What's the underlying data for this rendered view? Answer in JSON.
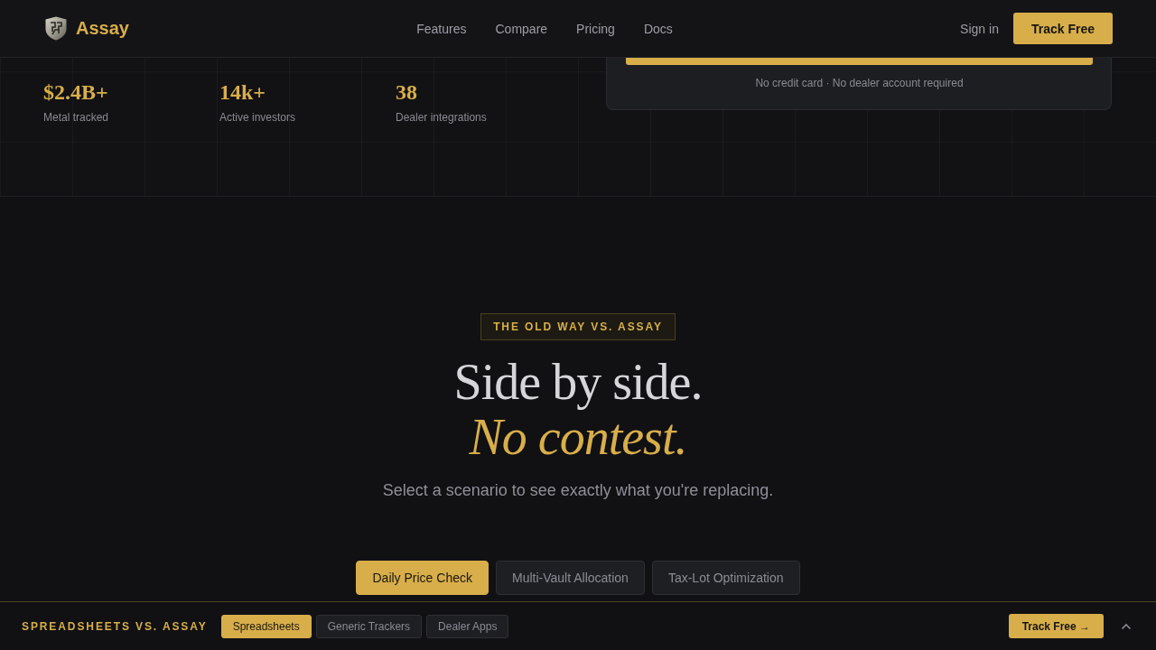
{
  "header": {
    "brand": "Assay",
    "nav": [
      "Features",
      "Compare",
      "Pricing",
      "Docs"
    ],
    "sign_in": "Sign in",
    "cta": "Track Free"
  },
  "hero": {
    "stats": [
      {
        "value": "$2.4B+",
        "label": "Metal tracked"
      },
      {
        "value": "14k+",
        "label": "Active investors"
      },
      {
        "value": "38",
        "label": "Dealer integrations"
      }
    ],
    "signup_card": {
      "note": "No credit card · No dealer account required"
    }
  },
  "comparison": {
    "eyebrow": "THE OLD WAY VS. ASSAY",
    "title": "Side by side.",
    "title_accent": "No contest.",
    "subtitle": "Select a scenario to see exactly what you're replacing.",
    "scenarios": [
      {
        "label": "Daily Price Check",
        "selected": true
      },
      {
        "label": "Multi-Vault Allocation",
        "selected": false
      },
      {
        "label": "Tax-Lot Optimization",
        "selected": false
      }
    ]
  },
  "sticky_bar": {
    "title": "SPREADSHEETS VS. ASSAY",
    "options": [
      {
        "label": "Spreadsheets",
        "selected": true
      },
      {
        "label": "Generic Trackers",
        "selected": false
      },
      {
        "label": "Dealer Apps",
        "selected": false
      }
    ],
    "cta": "Track Free →"
  }
}
